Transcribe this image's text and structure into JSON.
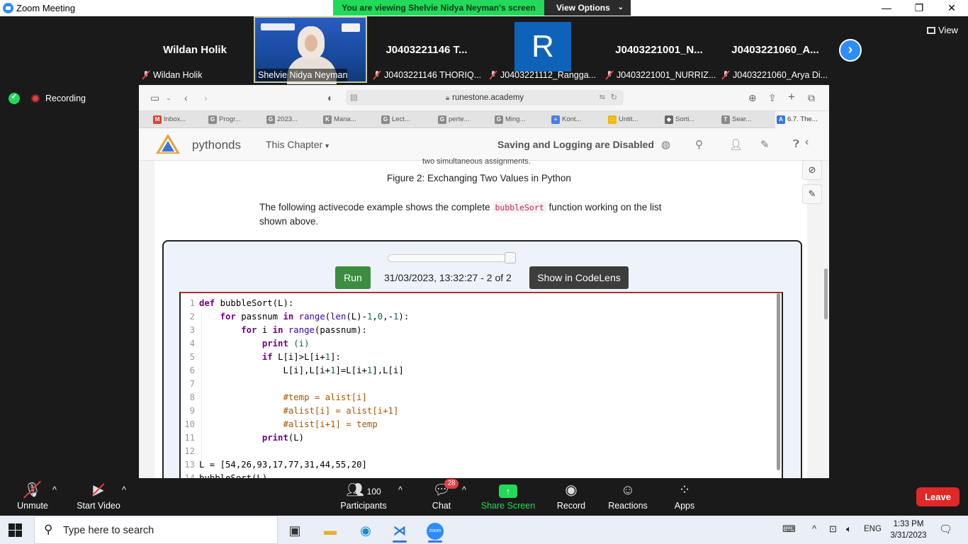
{
  "window": {
    "title": "Zoom Meeting",
    "controls": [
      "minimize",
      "restore",
      "close"
    ]
  },
  "banner": {
    "viewing_text": "You are viewing Shelvie Nidya Neyman's screen",
    "view_options_label": "View Options"
  },
  "view_button_label": "View",
  "participants": [
    {
      "big_name": "Wildan Holik",
      "caption": "Wildan Holik",
      "muted": true,
      "type": "name"
    },
    {
      "big_name": "",
      "caption": "Shelvie Nidya Neyman",
      "muted": false,
      "type": "video"
    },
    {
      "big_name": "J0403221146 T...",
      "caption": "J0403221146 THORIQ...",
      "muted": true,
      "type": "name"
    },
    {
      "big_name": "R",
      "caption": "J0403221112_Rangga...",
      "muted": true,
      "type": "avatar"
    },
    {
      "big_name": "J0403221001_N...",
      "caption": "J0403221001_NURRIZ...",
      "muted": true,
      "type": "name"
    },
    {
      "big_name": "J0403221060_A...",
      "caption": "J0403221060_Arya Di...",
      "muted": true,
      "type": "name"
    }
  ],
  "recording_label": "Recording",
  "browser": {
    "url": "runestone.academy",
    "tabs": [
      {
        "label": "Inbox...",
        "icon": "M",
        "color": "#d44638"
      },
      {
        "label": "Progr...",
        "icon": "G",
        "color": "#8a8a8a"
      },
      {
        "label": "2023...",
        "icon": "G",
        "color": "#8a8a8a"
      },
      {
        "label": "Mana...",
        "icon": "K",
        "color": "#8a8a8a"
      },
      {
        "label": "Lect...",
        "icon": "G",
        "color": "#8a8a8a"
      },
      {
        "label": "perte...",
        "icon": "G",
        "color": "#8a8a8a"
      },
      {
        "label": "Ming...",
        "icon": "G",
        "color": "#8a8a8a"
      },
      {
        "label": "Kont...",
        "icon": "≡",
        "color": "#4b7be5"
      },
      {
        "label": "Untit...",
        "icon": "□",
        "color": "#f2b705"
      },
      {
        "label": "Sorti...",
        "icon": "◆",
        "color": "#666666"
      },
      {
        "label": "Sear...",
        "icon": "T",
        "color": "#8a8a8a"
      },
      {
        "label": "6.7. The...",
        "icon": "A",
        "color": "#3c78d8"
      }
    ]
  },
  "runestone": {
    "brand": "pythonds",
    "chapter_menu": "This Chapter",
    "saving_status": "Saving and Logging are Disabled",
    "cut_text": "two simultaneous assignments.",
    "figure_caption": "Figure 2: Exchanging Two Values in Python",
    "intro_before": "The following activecode example shows the complete ",
    "intro_code": "bubbleSort",
    "intro_after": " function working on the list shown above.",
    "run_label": "Run",
    "timestamp": "31/03/2023, 13:32:27 - 2 of 2",
    "codelens_label": "Show in CodeLens",
    "code_lines": [
      [
        {
          "t": "kw",
          "s": "def "
        },
        {
          "t": "plain",
          "s": "bubbleSort(L):"
        }
      ],
      [
        {
          "t": "plain",
          "s": "    "
        },
        {
          "t": "kw",
          "s": "for "
        },
        {
          "t": "plain",
          "s": "passnum "
        },
        {
          "t": "kw",
          "s": "in "
        },
        {
          "t": "bi",
          "s": "range"
        },
        {
          "t": "plain",
          "s": "("
        },
        {
          "t": "bi",
          "s": "len"
        },
        {
          "t": "plain",
          "s": "(L)-"
        },
        {
          "t": "nm",
          "s": "1"
        },
        {
          "t": "plain",
          "s": ","
        },
        {
          "t": "nm",
          "s": "0"
        },
        {
          "t": "plain",
          "s": ",-"
        },
        {
          "t": "nm",
          "s": "1"
        },
        {
          "t": "plain",
          "s": "):"
        }
      ],
      [
        {
          "t": "plain",
          "s": "        "
        },
        {
          "t": "kw",
          "s": "for "
        },
        {
          "t": "plain",
          "s": "i "
        },
        {
          "t": "kw",
          "s": "in "
        },
        {
          "t": "bi",
          "s": "range"
        },
        {
          "t": "plain",
          "s": "(passnum):"
        }
      ],
      [
        {
          "t": "plain",
          "s": "            "
        },
        {
          "t": "kw",
          "s": "print "
        },
        {
          "t": "nm",
          "s": "(i)"
        }
      ],
      [
        {
          "t": "plain",
          "s": "            "
        },
        {
          "t": "kw",
          "s": "if "
        },
        {
          "t": "plain",
          "s": "L[i]>L[i+"
        },
        {
          "t": "nm",
          "s": "1"
        },
        {
          "t": "plain",
          "s": "]:"
        }
      ],
      [
        {
          "t": "plain",
          "s": "                L[i],L[i+"
        },
        {
          "t": "nm",
          "s": "1"
        },
        {
          "t": "plain",
          "s": "]=L[i+"
        },
        {
          "t": "nm",
          "s": "1"
        },
        {
          "t": "plain",
          "s": "],L[i]"
        }
      ],
      [
        {
          "t": "plain",
          "s": ""
        }
      ],
      [
        {
          "t": "plain",
          "s": "                "
        },
        {
          "t": "cm",
          "s": "#temp = alist[i]"
        }
      ],
      [
        {
          "t": "plain",
          "s": "                "
        },
        {
          "t": "cm",
          "s": "#alist[i] = alist[i+1]"
        }
      ],
      [
        {
          "t": "plain",
          "s": "                "
        },
        {
          "t": "cm",
          "s": "#alist[i+1] = temp"
        }
      ],
      [
        {
          "t": "plain",
          "s": "            "
        },
        {
          "t": "kw",
          "s": "print"
        },
        {
          "t": "plain",
          "s": "(L)"
        }
      ],
      [
        {
          "t": "plain",
          "s": ""
        }
      ],
      [
        {
          "t": "plain",
          "s": "L = [54,26,93,17,77,31,44,55,20]"
        }
      ],
      [
        {
          "t": "plain",
          "s": "bubbleSort(L)"
        }
      ]
    ]
  },
  "toolbar": {
    "unmute": "Unmute",
    "start_video": "Start Video",
    "participants": "Participants",
    "participants_count": "100",
    "chat": "Chat",
    "chat_badge": "28",
    "share_screen": "Share Screen",
    "record": "Record",
    "reactions": "Reactions",
    "apps": "Apps",
    "leave": "Leave"
  },
  "taskbar": {
    "search_placeholder": "Type here to search",
    "language": "ENG",
    "time": "1:33 PM",
    "date": "3/31/2023"
  }
}
